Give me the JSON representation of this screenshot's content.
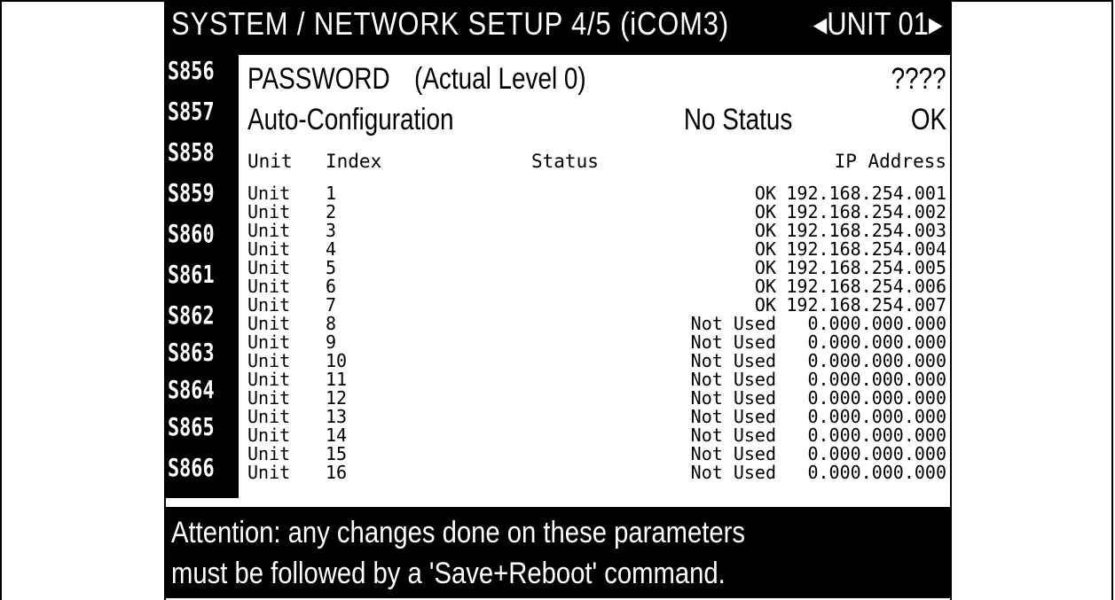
{
  "header": {
    "title": "SYSTEM / NETWORK SETUP 4/5 (iCOM3)",
    "unit_selector": "◂UNIT  01▸"
  },
  "side_codes": [
    "S856",
    "S857",
    "S858",
    "S859",
    "S860",
    "S861",
    "S862",
    "S863",
    "S864",
    "S865",
    "S866"
  ],
  "password": {
    "label": "PASSWORD",
    "level": "(Actual Level  0)",
    "value": "????"
  },
  "auto_config": {
    "label": "Auto-Configuration",
    "status": "No Status",
    "result": "OK"
  },
  "table": {
    "col_unit": "Unit",
    "col_index": "Index",
    "col_status": "Status",
    "col_ip": "IP Address",
    "rows": [
      {
        "unit": "Unit",
        "index": "1",
        "status": "OK",
        "ip": "192.168.254.001"
      },
      {
        "unit": "Unit",
        "index": "2",
        "status": "OK",
        "ip": "192.168.254.002"
      },
      {
        "unit": "Unit",
        "index": "3",
        "status": "OK",
        "ip": "192.168.254.003"
      },
      {
        "unit": "Unit",
        "index": "4",
        "status": "OK",
        "ip": "192.168.254.004"
      },
      {
        "unit": "Unit",
        "index": "5",
        "status": "OK",
        "ip": "192.168.254.005"
      },
      {
        "unit": "Unit",
        "index": "6",
        "status": "OK",
        "ip": "192.168.254.006"
      },
      {
        "unit": "Unit",
        "index": "7",
        "status": "OK",
        "ip": "192.168.254.007"
      },
      {
        "unit": "Unit",
        "index": "8",
        "status": "Not Used",
        "ip": "0.000.000.000"
      },
      {
        "unit": "Unit",
        "index": "9",
        "status": "Not Used",
        "ip": "0.000.000.000"
      },
      {
        "unit": "Unit",
        "index": "10",
        "status": "Not Used",
        "ip": "0.000.000.000"
      },
      {
        "unit": "Unit",
        "index": "11",
        "status": "Not Used",
        "ip": "0.000.000.000"
      },
      {
        "unit": "Unit",
        "index": "12",
        "status": "Not Used",
        "ip": "0.000.000.000"
      },
      {
        "unit": "Unit",
        "index": "13",
        "status": "Not Used",
        "ip": "0.000.000.000"
      },
      {
        "unit": "Unit",
        "index": "14",
        "status": "Not Used",
        "ip": "0.000.000.000"
      },
      {
        "unit": "Unit",
        "index": "15",
        "status": "Not Used",
        "ip": "0.000.000.000"
      },
      {
        "unit": "Unit",
        "index": "16",
        "status": "Not Used",
        "ip": "0.000.000.000"
      }
    ]
  },
  "footer": {
    "line1": "Attention: any changes done on these parameters",
    "line2": "must be followed by a 'Save+Reboot' command."
  }
}
